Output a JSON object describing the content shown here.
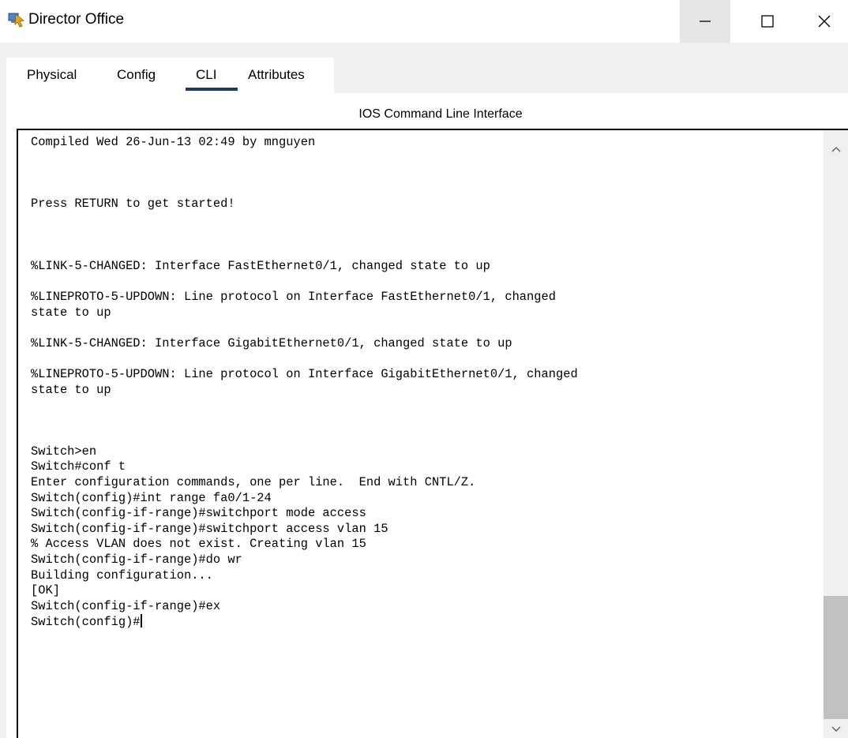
{
  "window": {
    "title": "Director Office",
    "icon": "packet-tracer-pc-icon"
  },
  "window_controls": {
    "minimize_icon": "minimize-icon",
    "maximize_icon": "maximize-icon",
    "close_icon": "close-icon"
  },
  "tabs": [
    {
      "label": "Physical",
      "active": false
    },
    {
      "label": "Config",
      "active": false
    },
    {
      "label": "CLI",
      "active": true
    },
    {
      "label": "Attributes",
      "active": false
    }
  ],
  "cli": {
    "header": "IOS Command Line Interface",
    "lines": [
      "Compiled Wed 26-Jun-13 02:49 by mnguyen",
      "",
      "",
      "",
      "Press RETURN to get started!",
      "",
      "",
      "",
      "%LINK-5-CHANGED: Interface FastEthernet0/1, changed state to up",
      "",
      "%LINEPROTO-5-UPDOWN: Line protocol on Interface FastEthernet0/1, changed",
      "state to up",
      "",
      "%LINK-5-CHANGED: Interface GigabitEthernet0/1, changed state to up",
      "",
      "%LINEPROTO-5-UPDOWN: Line protocol on Interface GigabitEthernet0/1, changed",
      "state to up",
      "",
      "",
      "",
      "Switch>en",
      "Switch#conf t",
      "Enter configuration commands, one per line.  End with CNTL/Z.",
      "Switch(config)#int range fa0/1-24",
      "Switch(config-if-range)#switchport mode access",
      "Switch(config-if-range)#switchport access vlan 15",
      "% Access VLAN does not exist. Creating vlan 15",
      "Switch(config-if-range)#do wr",
      "Building configuration...",
      "[OK]",
      "Switch(config-if-range)#ex"
    ],
    "prompt": "Switch(config)#"
  },
  "scrollbar": {
    "up_icon": "scroll-up-arrow-icon",
    "down_icon": "scroll-down-arrow-icon"
  }
}
